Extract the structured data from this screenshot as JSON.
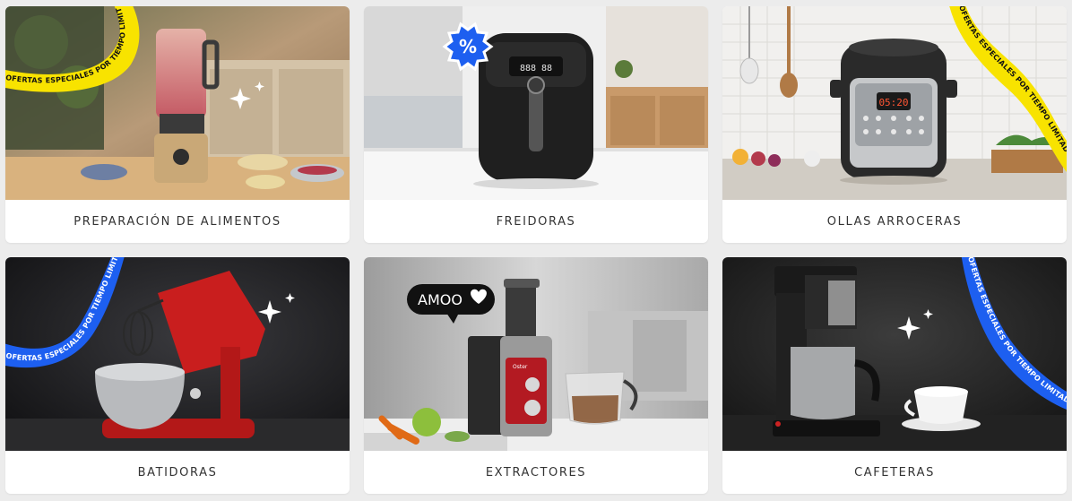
{
  "theme": {
    "page_bg": "#ececec",
    "card_bg": "#ffffff",
    "label_color": "#333333",
    "promo_yellow": "#f8e300",
    "promo_blue": "#1d5ff0"
  },
  "categories": [
    {
      "label": "PREPARACIÓN DE ALIMENTOS",
      "image": "blender-kitchen-photo",
      "badge_text": "OFERTAS ESPECIALES POR TIEMPO LIMITADO",
      "badge_color": "#f8e300"
    },
    {
      "label": "FREIDORAS",
      "image": "air-fryer-photo",
      "badge_icon": "percent-badge-icon",
      "badge_symbol": "%",
      "display_text": "888 88"
    },
    {
      "label": "OLLAS ARROCERAS",
      "image": "pressure-cooker-photo",
      "badge_text": "OFERTAS ESPECIALES POR TIEMPO LIMITADO",
      "badge_color": "#f8e300",
      "display_text": "05:20"
    },
    {
      "label": "BATIDORAS",
      "image": "stand-mixer-photo",
      "badge_text": "OFERTAS ESPECIALES POR TIEMPO LIMITADO",
      "badge_color": "#1d5ff0"
    },
    {
      "label": "EXTRACTORES",
      "image": "juicer-photo",
      "bubble_text": "AMOO",
      "bubble_icon": "heart-icon",
      "brand_text": "Oster"
    },
    {
      "label": "CAFETERAS",
      "image": "coffee-maker-photo",
      "badge_text": "OFERTAS ESPECIALES POR TIEMPO LIMITADO",
      "badge_color": "#1d5ff0"
    }
  ]
}
